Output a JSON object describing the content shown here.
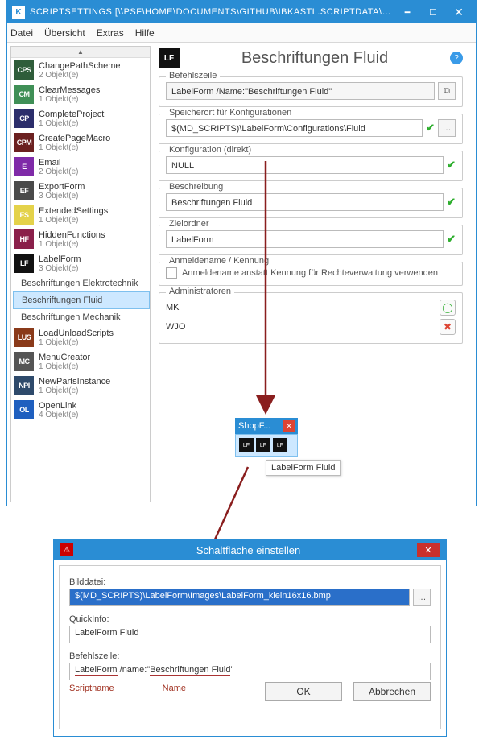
{
  "window1": {
    "title": "SCRIPTSETTINGS [\\\\PSF\\HOME\\DOCUMENTS\\GITHUB\\IBKASTL.SCRIPTDATA\\SCRI...",
    "menu": {
      "file": "Datei",
      "overview": "Übersicht",
      "extras": "Extras",
      "help": "Hilfe"
    }
  },
  "sidebar": [
    {
      "code": "CPS",
      "color": "#2f5d3a",
      "name": "ChangePathScheme",
      "count": "2 Objekt(e)"
    },
    {
      "code": "CM",
      "color": "#3f8f56",
      "name": "ClearMessages",
      "count": "1 Objekt(e)"
    },
    {
      "code": "CP",
      "color": "#2c2e6b",
      "name": "CompleteProject",
      "count": "1 Objekt(e)"
    },
    {
      "code": "CPM",
      "color": "#6b2020",
      "name": "CreatePageMacro",
      "count": "1 Objekt(e)"
    },
    {
      "code": "E",
      "color": "#7f2aa8",
      "name": "Email",
      "count": "2 Objekt(e)"
    },
    {
      "code": "EF",
      "color": "#4a4a4a",
      "name": "ExportForm",
      "count": "3 Objekt(e)"
    },
    {
      "code": "ES",
      "color": "#e4d24a",
      "name": "ExtendedSettings",
      "count": "1 Objekt(e)"
    },
    {
      "code": "HF",
      "color": "#8a1f4a",
      "name": "HiddenFunctions",
      "count": "1 Objekt(e)"
    },
    {
      "code": "LF",
      "color": "#111111",
      "name": "LabelForm",
      "count": "3 Objekt(e)"
    },
    {
      "code": "LUS",
      "color": "#8a3a1a",
      "name": "LoadUnloadScripts",
      "count": "1 Objekt(e)"
    },
    {
      "code": "MC",
      "color": "#555555",
      "name": "MenuCreator",
      "count": "1 Objekt(e)"
    },
    {
      "code": "NPI",
      "color": "#2e4a6b",
      "name": "NewPartsInstance",
      "count": "1 Objekt(e)"
    },
    {
      "code": "OL",
      "color": "#1f5fbf",
      "name": "OpenLink",
      "count": "4 Objekt(e)"
    }
  ],
  "sidebar_sub": {
    "a": "Beschriftungen Elektrotechnik",
    "b": "Beschriftungen Fluid",
    "c": "Beschriftungen Mechanik"
  },
  "rpane": {
    "badge": "LF",
    "title": "Beschriftungen Fluid",
    "g1_legend": "Befehlszeile",
    "g1_value": "LabelForm /Name:\"Beschriftungen Fluid\"",
    "g2_legend": "Speicherort für Konfigurationen",
    "g2_value": "$(MD_SCRIPTS)\\LabelForm\\Configurations\\Fluid",
    "g3_legend": "Konfiguration (direkt)",
    "g3_value": "NULL",
    "g4_legend": "Beschreibung",
    "g4_value": "Beschriftungen Fluid",
    "g5_legend": "Zielordner",
    "g5_value": "LabelForm",
    "g6_legend": "Anmeldename / Kennung",
    "g6_chk": "Anmeldename anstatt Kennung für Rechteverwaltung verwenden",
    "g7_legend": "Administratoren",
    "g7_a": "MK",
    "g7_b": "WJO"
  },
  "toolbar": {
    "label": "ShopF...",
    "tooltip": "LabelForm Fluid"
  },
  "window2": {
    "title": "Schaltfläche einstellen",
    "lbl_img": "Bilddatei:",
    "val_img": "$(MD_SCRIPTS)\\LabelForm\\Images\\LabelForm_klein16x16.bmp",
    "lbl_qi": "QuickInfo:",
    "val_qi": "LabelForm Fluid",
    "lbl_cmd": "Befehlszeile:",
    "val_cmd_a": "LabelForm",
    "val_cmd_mid": " /name:\"",
    "val_cmd_b": "Beschriftungen Fluid",
    "val_cmd_end": "\"",
    "tag_a": "Scriptname",
    "tag_b": "Name",
    "ok": "OK",
    "cancel": "Abbrechen"
  }
}
